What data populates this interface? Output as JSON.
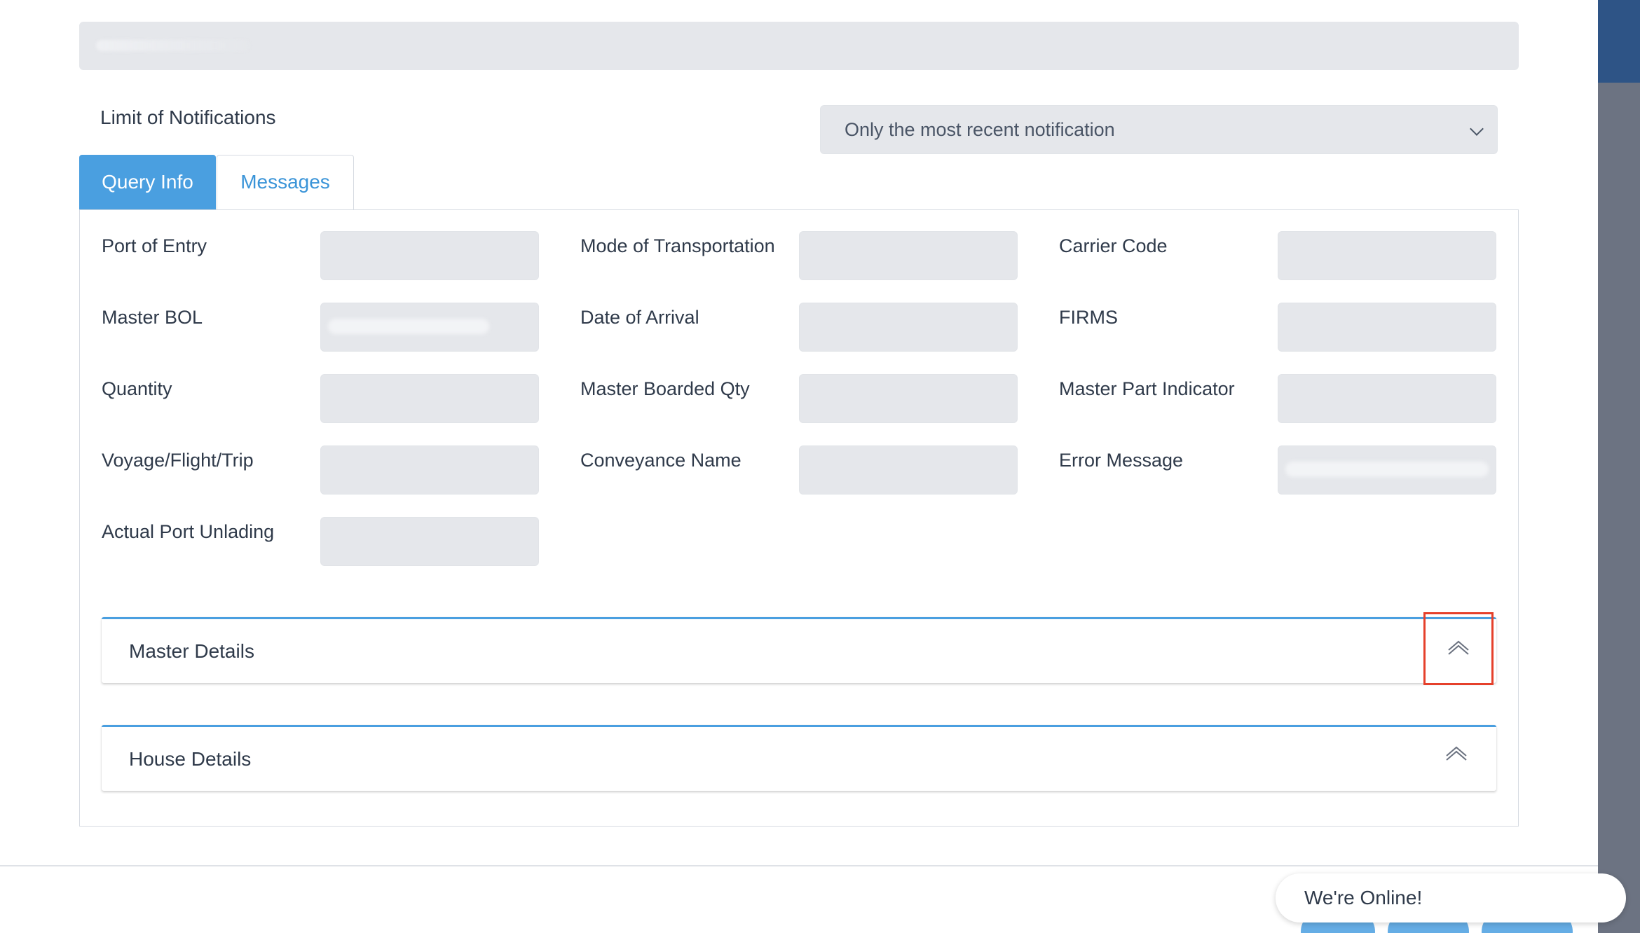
{
  "limit": {
    "label": "Limit of Notifications",
    "selected": "Only the most recent notification"
  },
  "tabs": [
    {
      "label": "Query Info",
      "active": true
    },
    {
      "label": "Messages",
      "active": false
    }
  ],
  "fields": {
    "port_of_entry": "Port of Entry",
    "mode_of_transportation": "Mode of Transportation",
    "carrier_code": "Carrier Code",
    "master_bol": "Master BOL",
    "date_of_arrival": "Date of Arrival",
    "firms": "FIRMS",
    "quantity": "Quantity",
    "master_boarded_qty": "Master Boarded Qty",
    "master_part_indicator": "Master Part Indicator",
    "voyage_flight_trip": "Voyage/Flight/Trip",
    "conveyance_name": "Conveyance Name",
    "error_message": "Error Message",
    "actual_port_unlading": "Actual Port Unlading"
  },
  "sections": {
    "master_details": "Master Details",
    "house_details": "House Details"
  },
  "chat": {
    "status": "We're Online!"
  },
  "colors": {
    "accent": "#4a9fe0",
    "highlight": "#e5402b",
    "input_bg": "#e5e7eb"
  },
  "icons": {
    "dropdown": "chevron-down-icon",
    "accordion": "chevron-up-icon"
  }
}
